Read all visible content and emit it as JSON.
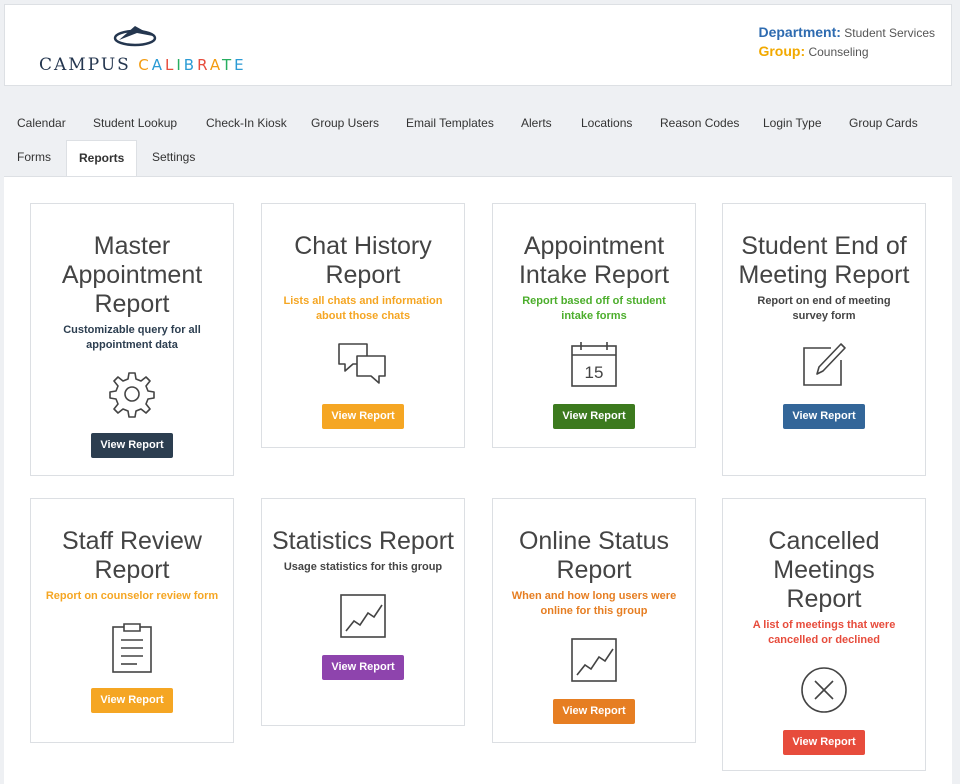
{
  "brand": {
    "word1": "CAMPUS",
    "word2": "CALIBRATE",
    "word2_letters": [
      "C",
      "A",
      "L",
      "I",
      "B",
      "R",
      "A",
      "T",
      "E"
    ],
    "word2_colors": [
      "#f39c12",
      "#2b9bd4",
      "#e74c3c",
      "#27ae60",
      "#2b9bd4",
      "#e74c3c",
      "#f39c12",
      "#27ae60",
      "#2b9bd4"
    ]
  },
  "context": {
    "department_label": "Department:",
    "department_value": "Student Services",
    "group_label": "Group:",
    "group_value": "Counseling"
  },
  "nav": {
    "tabs": [
      {
        "label": "Calendar"
      },
      {
        "label": "Student Lookup"
      },
      {
        "label": "Check-In Kiosk"
      },
      {
        "label": "Group Users"
      },
      {
        "label": "Email Templates"
      },
      {
        "label": "Alerts"
      },
      {
        "label": "Locations"
      },
      {
        "label": "Reason Codes"
      },
      {
        "label": "Login Type"
      },
      {
        "label": "Group Cards"
      },
      {
        "label": "Forms"
      },
      {
        "label": "Reports"
      },
      {
        "label": "Settings"
      }
    ],
    "active": "Reports"
  },
  "reports": [
    {
      "title": "Master Appointment Report",
      "description": "Customizable query for all appointment data",
      "icon": "gear-icon",
      "button": "View Report",
      "desc_color": "#2c3e50",
      "btn_color": "#2c3e50"
    },
    {
      "title": "Chat History Report",
      "description": "Lists all chats and information about those chats",
      "icon": "chat-icon",
      "button": "View Report",
      "desc_color": "#f5a623",
      "btn_color": "#f5a623"
    },
    {
      "title": "Appointment Intake Report",
      "description": "Report based off of student intake forms",
      "icon": "calendar-icon",
      "button": "View Report",
      "desc_color": "#4cae2c",
      "btn_color": "#3c7a1e"
    },
    {
      "title": "Student End of Meeting Report",
      "description": "Report on end of meeting survey form",
      "icon": "edit-icon",
      "button": "View Report",
      "desc_color": "#444444",
      "btn_color": "#336699"
    },
    {
      "title": "Staff Review Report",
      "description": "Report on counselor review form",
      "icon": "clipboard-icon",
      "button": "View Report",
      "desc_color": "#f5a623",
      "btn_color": "#f5a623"
    },
    {
      "title": "Statistics Report",
      "description": "Usage statistics for this group",
      "icon": "chart-icon",
      "button": "View Report",
      "desc_color": "#444444",
      "btn_color": "#8e44ad"
    },
    {
      "title": "Online Status Report",
      "description": "When and how long users were online for this group",
      "icon": "chart-icon",
      "button": "View Report",
      "desc_color": "#e67e22",
      "btn_color": "#e67e22"
    },
    {
      "title": "Cancelled Meetings Report",
      "description": "A list of meetings that were cancelled or declined",
      "icon": "cancel-icon",
      "button": "View Report",
      "desc_color": "#e74c3c",
      "btn_color": "#e74c3c"
    }
  ],
  "calendar_icon_day": "15"
}
